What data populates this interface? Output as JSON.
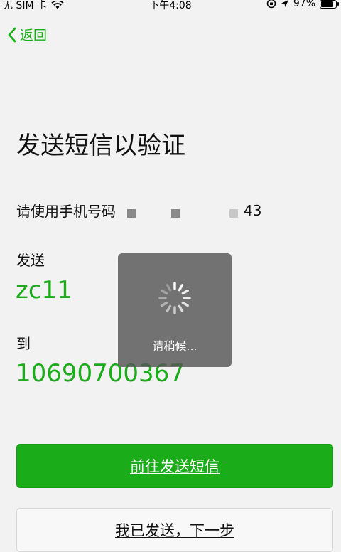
{
  "status_bar": {
    "carrier": "无 SIM 卡",
    "time": "下午4:08",
    "battery": "97%"
  },
  "nav": {
    "back_label": "返回"
  },
  "title": "发送短信以验证",
  "phone": {
    "prefix": "请使用手机号码",
    "visible_suffix": "43"
  },
  "send": {
    "label": "发送",
    "code": "zc11"
  },
  "to": {
    "label": "到",
    "number": "10690700367"
  },
  "buttons": {
    "primary": "前往发送短信",
    "secondary": "我已发送，下一步"
  },
  "loading": {
    "text": "请稍候..."
  },
  "colors": {
    "accent": "#1aad19",
    "background": "#f2f2f2",
    "toast": "#555555"
  }
}
